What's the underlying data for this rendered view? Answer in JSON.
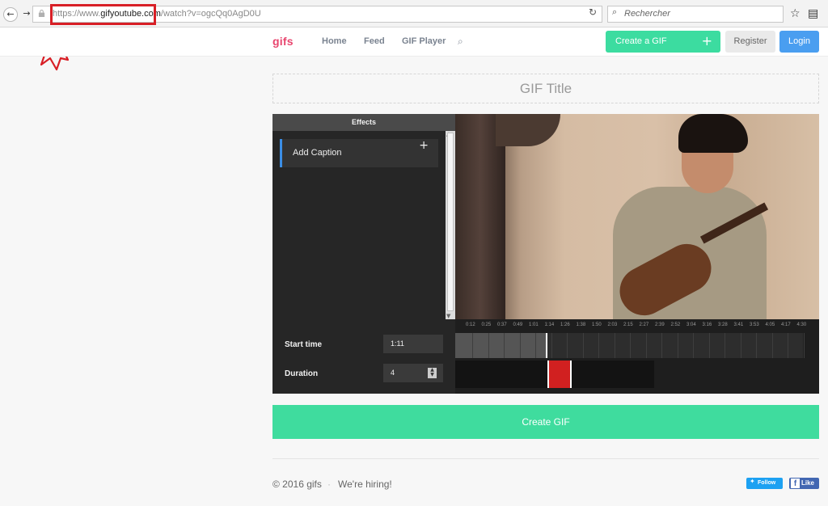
{
  "browser": {
    "url_scheme": "https://www.",
    "url_host": "gifyoutube.com",
    "url_path": "/watch?v=ogcQq0AgD0U",
    "search_placeholder": "Rechercher"
  },
  "header": {
    "logo": "gifs",
    "nav": [
      "Home",
      "Feed",
      "GIF Player"
    ],
    "create_label": "Create a GIF",
    "register_label": "Register",
    "login_label": "Login"
  },
  "editor": {
    "title_placeholder": "GIF Title",
    "effects_header": "Effects",
    "add_caption_label": "Add Caption",
    "start_time_label": "Start time",
    "start_time_value": "1:11",
    "duration_label": "Duration",
    "duration_value": "4",
    "timeline_ticks": [
      "0:12",
      "0:25",
      "0:37",
      "0:49",
      "1:01",
      "1:14",
      "1:26",
      "1:38",
      "1:50",
      "2:03",
      "2:15",
      "2:27",
      "2:39",
      "2:52",
      "3:04",
      "3:16",
      "3:28",
      "3:41",
      "3:53",
      "4:05",
      "4:17",
      "4:30"
    ]
  },
  "create_gif_button": "Create GIF",
  "footer": {
    "copyright": "© 2016 gifs",
    "hiring": "We're hiring!",
    "twitter_label": "Follow",
    "facebook_label": "Like"
  },
  "colors": {
    "accent_green": "#3fdc9e",
    "logo_pink": "#e8456e",
    "login_blue": "#4a9ef0",
    "annotation_red": "#d81f26"
  }
}
